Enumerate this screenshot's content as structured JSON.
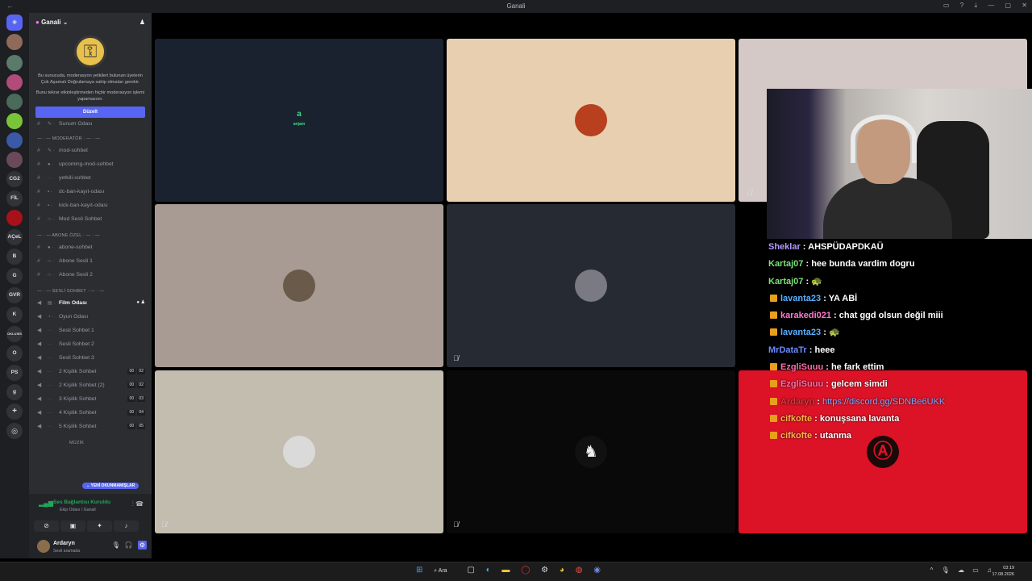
{
  "window": {
    "title": "Ganali",
    "back": "←"
  },
  "rail": {
    "labels": [
      "CG2",
      "FİL",
      "AÇeL",
      "B",
      "G",
      "GVR",
      "K",
      "OKLUSİS",
      "O",
      "PS",
      "g"
    ]
  },
  "sidebar": {
    "guild_name": "Ganali",
    "notice_line1": "Bu sunucuda, moderasyon yetkileri bulunan üyelerin Çok Aşamalı Doğrulamaya sahip olmaları gerekir.",
    "notice_line2": "Bunu tekrar etkinleştirmeden hiçbir moderasyon işlemi yapamazsın.",
    "fix_button": "Düzelt",
    "partial_top": "Sunum Odası",
    "categories": {
      "moderator": "— · — MODERATÖR · — · —",
      "abone": "— · — ABONE ÖZEL · — · —",
      "sesli": "— · — SESLİ SOHBET · — · —",
      "muzik": "MÜZİK"
    },
    "mod_channels": [
      "mod-sohbet",
      "upcoming-mod-sohbet",
      "yetkili-sohbet",
      "dc-ban-kayıt-odası",
      "kick-ban-kayıt-odası",
      "Mod Sesli Sohbet"
    ],
    "abone_channels": [
      "abone-sohbet",
      "Abone Sesli 1",
      "Abone Sesli 2"
    ],
    "voice_channels": [
      "Film Odası",
      "Oyun Odası",
      "Sesli Sohbet 1",
      "Sesli Sohbet 2",
      "Sesli Sohbet 3",
      "2 Kişilik Sohbet",
      "2 Kişilik Sohbet (2)",
      "3 Kişilik Sohbet",
      "4 Kişilik Sohbet",
      "5 Kişilik Sohbet"
    ],
    "counts": [
      [
        "00",
        "02"
      ],
      [
        "00",
        "02"
      ],
      [
        "00",
        "03"
      ],
      [
        "00",
        "04"
      ],
      [
        "00",
        "05"
      ]
    ],
    "new_unread": "YENİ OKUNMAMIŞLAR"
  },
  "voice": {
    "status": "Ses Bağlantısı Kuruldu",
    "location": "Ekip Odası / Ganali"
  },
  "user": {
    "name": "Ardaryn",
    "status": "Sesli aramada"
  },
  "tiles": {
    "anjam_logo": "anjam",
    "colors": [
      "#1a2230",
      "#e8cfb0",
      "#d4c9c7",
      "#a79b94",
      "#262a33",
      "#000000",
      "#c3bdaf",
      "#090909",
      "#dc1226"
    ]
  },
  "chat": [
    {
      "user": "Sheklar",
      "color": "#b399ff",
      "text": "AHSPÜDAPDKAÜ",
      "badge": false
    },
    {
      "user": "Kartaj07",
      "color": "#7be07b",
      "text": "hee bunda vardim dogru",
      "badge": false
    },
    {
      "user": "Kartaj07",
      "color": "#7be07b",
      "text": "🐢",
      "badge": false
    },
    {
      "user": "lavanta23",
      "color": "#5ab0ff",
      "text": "YA ABİ",
      "badge": true
    },
    {
      "user": "karakedi021",
      "color": "#ff7ad1",
      "text": "chat ggd olsun değil miii",
      "badge": true
    },
    {
      "user": "lavanta23",
      "color": "#5ab0ff",
      "text": "🐢",
      "badge": true
    },
    {
      "user": "MrDataTr",
      "color": "#6b8cff",
      "text": "heee",
      "badge": false
    },
    {
      "user": "EzgliSuuu",
      "color": "#ff6fa8",
      "text": "he fark ettim",
      "badge": true
    },
    {
      "user": "EzgliSuuu",
      "color": "#ff6fa8",
      "text": "gelcem simdi",
      "badge": true
    },
    {
      "user": "Ardaryn",
      "color": "#d13a3a",
      "text": "https://discord.gg/SDNBe6UKK",
      "badge": true,
      "link": true
    },
    {
      "user": "cifkofte",
      "color": "#ffb44a",
      "text": "konuşsana lavanta",
      "badge": true
    },
    {
      "user": "cifkofte",
      "color": "#ffb44a",
      "text": "utanma",
      "badge": true
    }
  ],
  "taskbar": {
    "search": "Ara",
    "time": "03:19",
    "date": "17.08.2026"
  }
}
